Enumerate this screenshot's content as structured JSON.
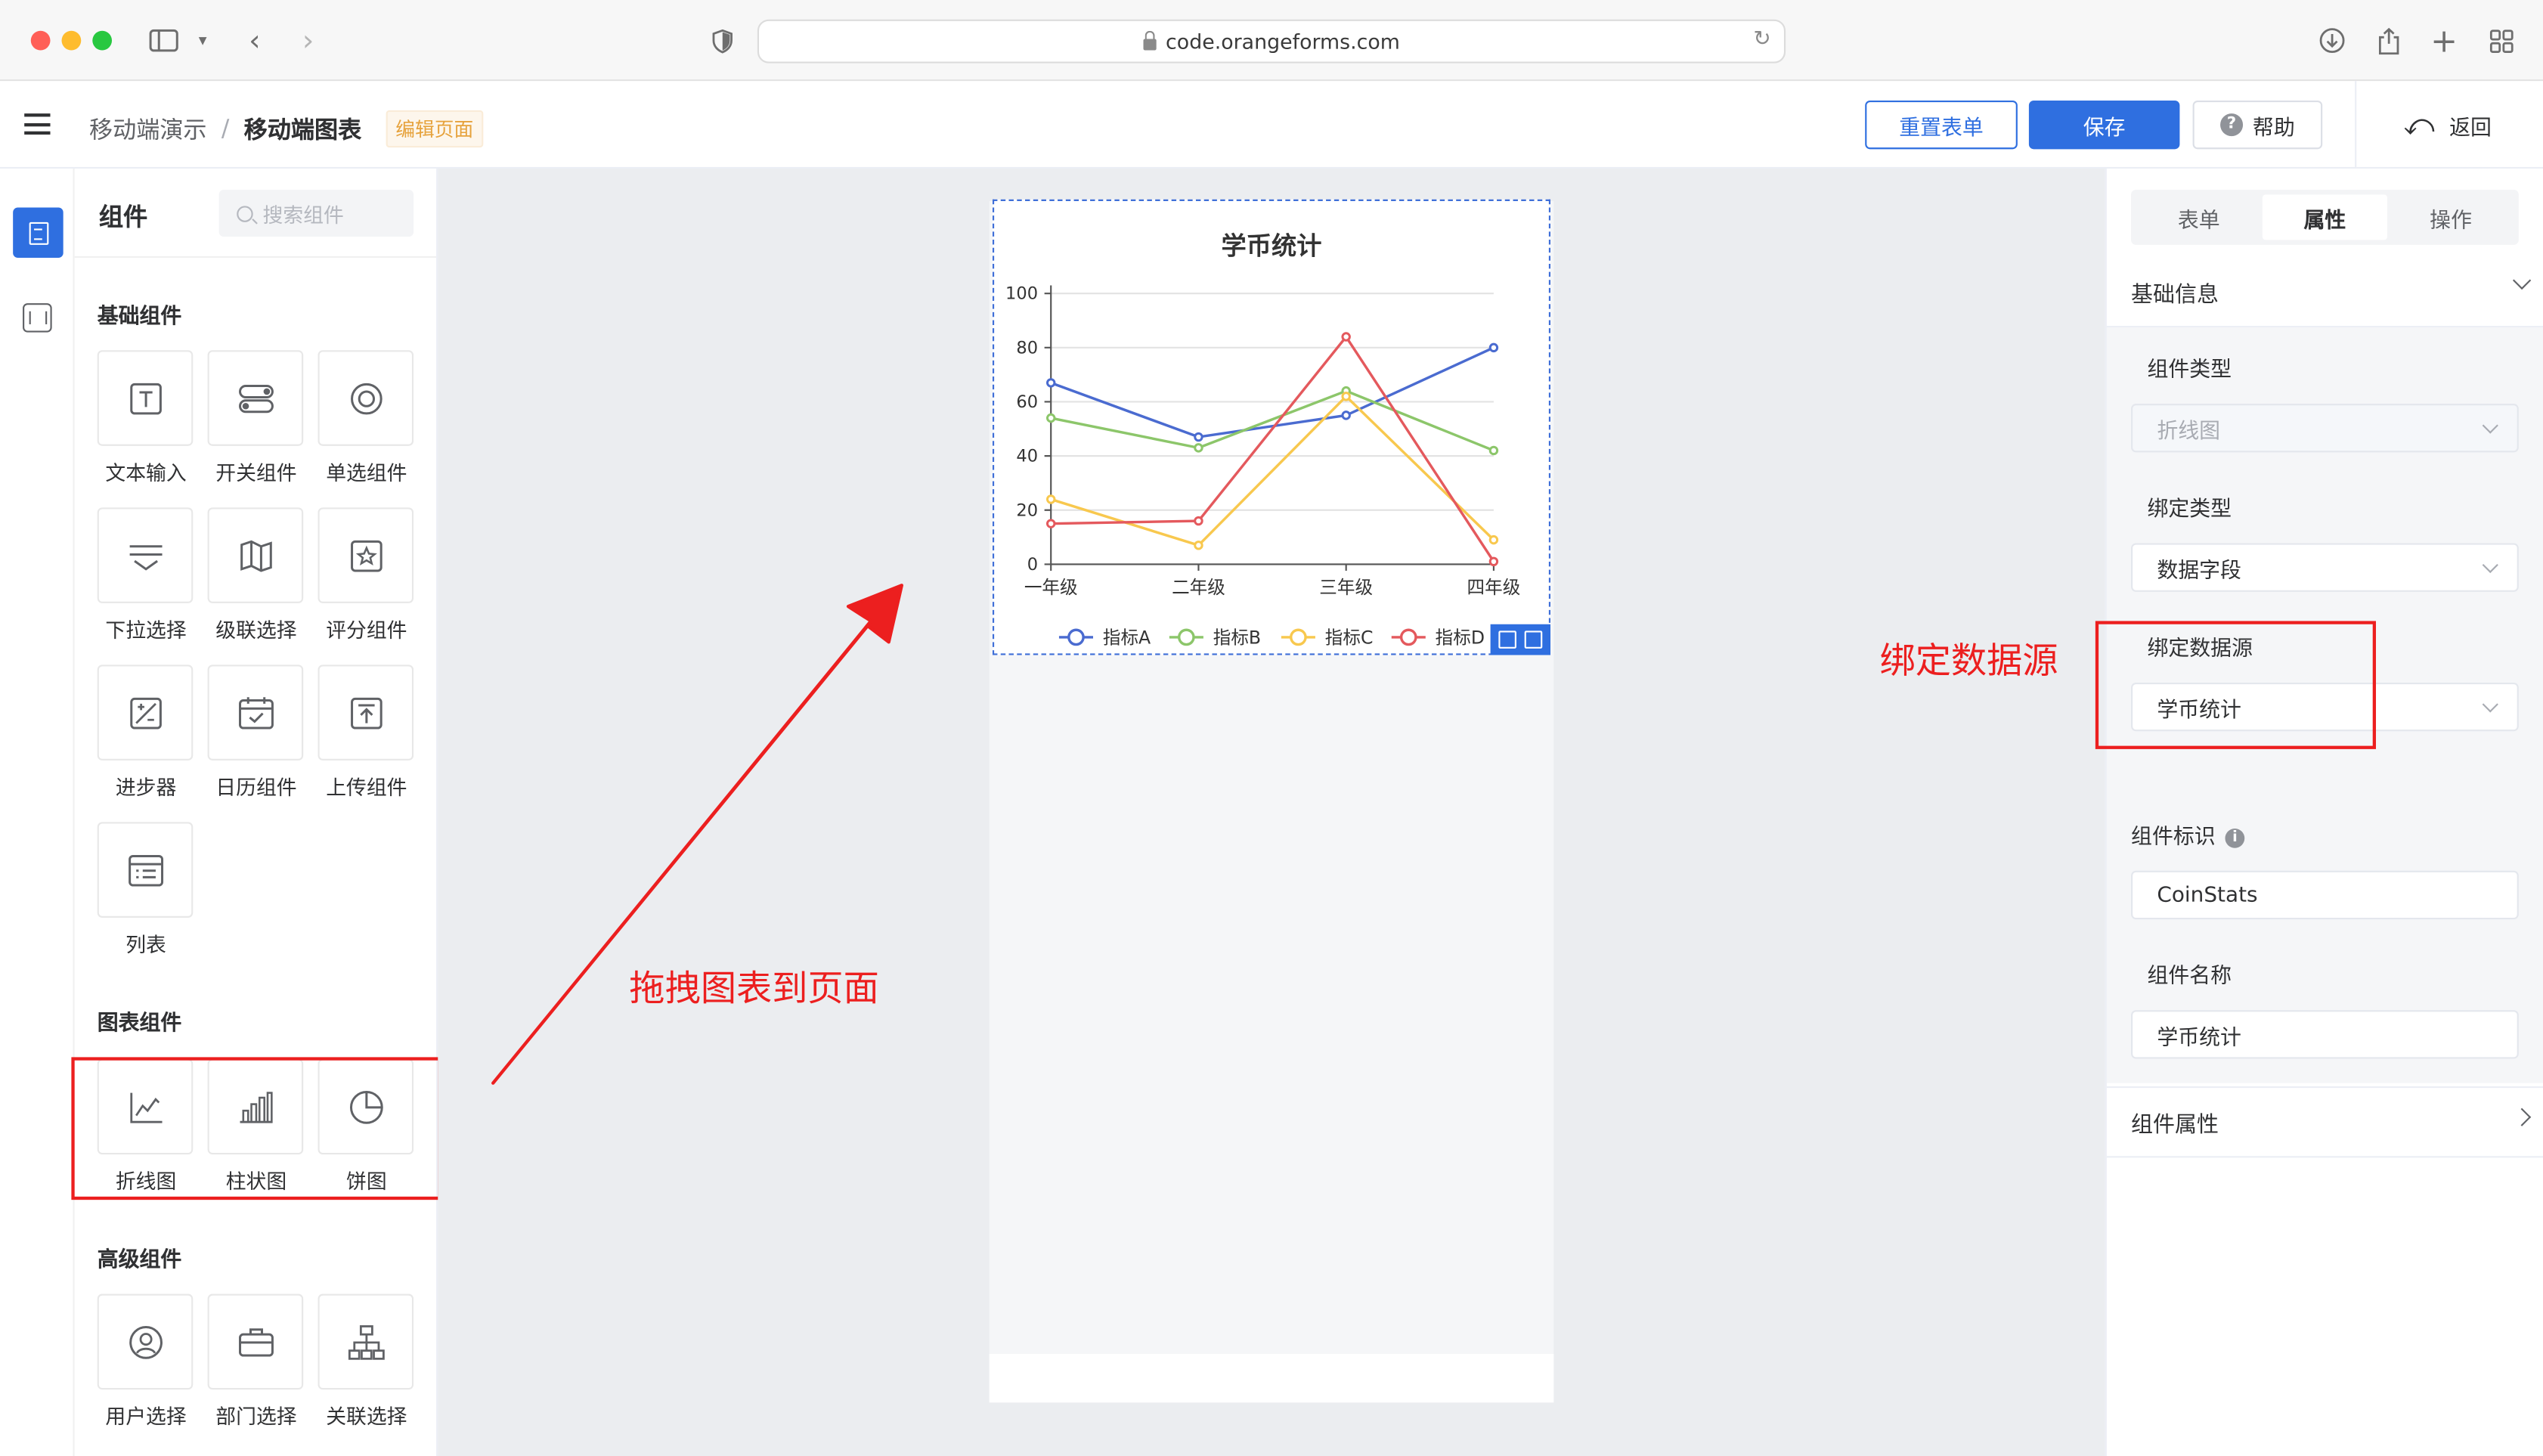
{
  "browser": {
    "url": "code.orangeforms.com"
  },
  "header": {
    "breadcrumb_parent": "移动端演示",
    "breadcrumb_sep": "/",
    "breadcrumb_current": "移动端图表",
    "mode_tag": "编辑页面",
    "reset_label": "重置表单",
    "save_label": "保存",
    "help_label": "帮助",
    "back_label": "返回",
    "accent_color": "#2f6fe0"
  },
  "component_panel": {
    "title": "组件",
    "search_placeholder": "搜索组件",
    "groups": [
      {
        "title": "基础组件",
        "items": [
          {
            "label": "文本输入",
            "icon": "text-input-icon"
          },
          {
            "label": "开关组件",
            "icon": "switch-icon"
          },
          {
            "label": "单选组件",
            "icon": "radio-icon"
          },
          {
            "label": "下拉选择",
            "icon": "dropdown-icon"
          },
          {
            "label": "级联选择",
            "icon": "cascader-icon"
          },
          {
            "label": "评分组件",
            "icon": "rate-star-icon"
          },
          {
            "label": "进步器",
            "icon": "stepper-icon"
          },
          {
            "label": "日历组件",
            "icon": "calendar-icon"
          },
          {
            "label": "上传组件",
            "icon": "upload-icon"
          },
          {
            "label": "列表",
            "icon": "list-icon"
          }
        ]
      },
      {
        "title": "图表组件",
        "items": [
          {
            "label": "折线图",
            "icon": "line-chart-icon"
          },
          {
            "label": "柱状图",
            "icon": "bar-chart-icon"
          },
          {
            "label": "饼图",
            "icon": "pie-chart-icon"
          }
        ]
      },
      {
        "title": "高级组件",
        "items": [
          {
            "label": "用户选择",
            "icon": "user-select-icon"
          },
          {
            "label": "部门选择",
            "icon": "department-icon"
          },
          {
            "label": "关联选择",
            "icon": "relation-tree-icon"
          }
        ]
      }
    ]
  },
  "annotations": {
    "drag_hint": "拖拽图表到页面",
    "bind_hint": "绑定数据源",
    "highlight_color": "#ec1f1f"
  },
  "chart_data": {
    "type": "line",
    "title": "学币统计",
    "categories": [
      "一年级",
      "二年级",
      "三年级",
      "四年级"
    ],
    "ylim": [
      0,
      100
    ],
    "yticks": [
      "0",
      "20",
      "40",
      "60",
      "80",
      "100"
    ],
    "grid": true,
    "legend_position": "bottom",
    "series": [
      {
        "name": "指标A",
        "color": "#4a6bd0",
        "values": [
          67,
          47,
          55,
          80
        ]
      },
      {
        "name": "指标B",
        "color": "#8cc66a",
        "values": [
          54,
          43,
          64,
          42
        ]
      },
      {
        "name": "指标C",
        "color": "#f8c84e",
        "values": [
          24,
          7,
          62,
          9
        ]
      },
      {
        "name": "指标D",
        "color": "#e4595d",
        "values": [
          15,
          16,
          84,
          1
        ]
      }
    ]
  },
  "properties_panel": {
    "tabs": [
      {
        "label": "表单"
      },
      {
        "label": "属性"
      },
      {
        "label": "操作"
      }
    ],
    "active_tab": "属性",
    "basic_section": "基础信息",
    "component_type_label": "组件类型",
    "component_type_value": "折线图",
    "bind_type_label": "绑定类型",
    "bind_type_value": "数据字段",
    "data_source_label": "绑定数据源",
    "data_source_value": "学币统计",
    "identifier_label": "组件标识",
    "identifier_value": "CoinStats",
    "name_label": "组件名称",
    "name_value": "学币统计",
    "attr_section": "组件属性"
  }
}
